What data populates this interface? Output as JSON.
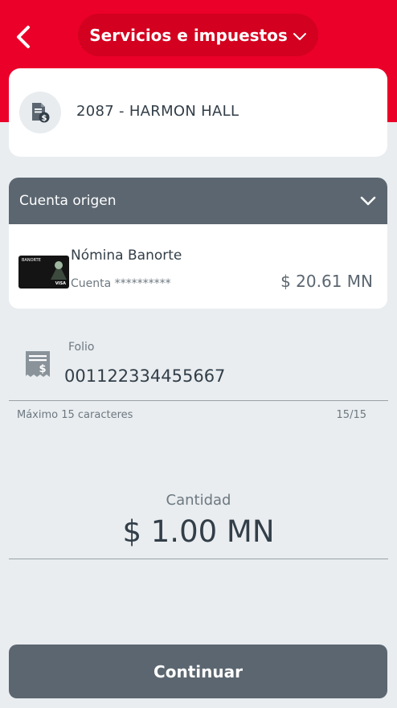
{
  "header": {
    "title": "Servicios e impuestos",
    "back_icon": "chevron-left-icon",
    "dropdown_icon": "chevron-down-icon",
    "brand_color": "#eb0029"
  },
  "service": {
    "icon": "bill-dollar-icon",
    "name": "2087 - HARMON HALL"
  },
  "origin": {
    "title": "Cuenta origen",
    "toggle_icon": "chevron-down-icon",
    "account_name": "Nómina Banorte",
    "account_number": "Cuenta **********",
    "balance": "$ 20.61 MN",
    "card_brand": "BANORTE",
    "card_network": "VISA"
  },
  "folio": {
    "icon": "receipt-dollar-icon",
    "label": "Folio",
    "value": "001122334455667",
    "hint": "Máximo 15 caracteres",
    "count": "15/15"
  },
  "amount": {
    "label": "Cantidad",
    "value": "$ 1.00 MN"
  },
  "actions": {
    "continue_label": "Continuar"
  }
}
